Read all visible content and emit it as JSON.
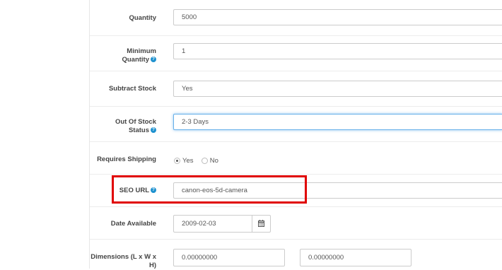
{
  "form": {
    "quantity": {
      "label": "Quantity",
      "value": "5000"
    },
    "minimum_quantity": {
      "label_line1": "Minimum",
      "label_line2": "Quantity",
      "value": "1"
    },
    "subtract_stock": {
      "label": "Subtract Stock",
      "value": "Yes"
    },
    "out_of_stock_status": {
      "label_line1": "Out Of Stock",
      "label_line2": "Status",
      "value": "2-3 Days"
    },
    "requires_shipping": {
      "label": "Requires Shipping",
      "options": [
        "Yes",
        "No"
      ],
      "selected": "Yes"
    },
    "seo_url": {
      "label": "SEO URL",
      "value": "canon-eos-5d-camera"
    },
    "date_available": {
      "label": "Date Available",
      "value": "2009-02-03"
    },
    "dimensions": {
      "label_line1": "Dimensions (L x W x",
      "label_line2": "H)",
      "length": "0.00000000",
      "width": "0.00000000"
    }
  },
  "icons": {
    "help": "question-circle-icon",
    "calendar": "calendar-icon"
  },
  "colors": {
    "highlight": "#e00000",
    "help": "#1e91cf",
    "focus_border": "#66afe9"
  }
}
